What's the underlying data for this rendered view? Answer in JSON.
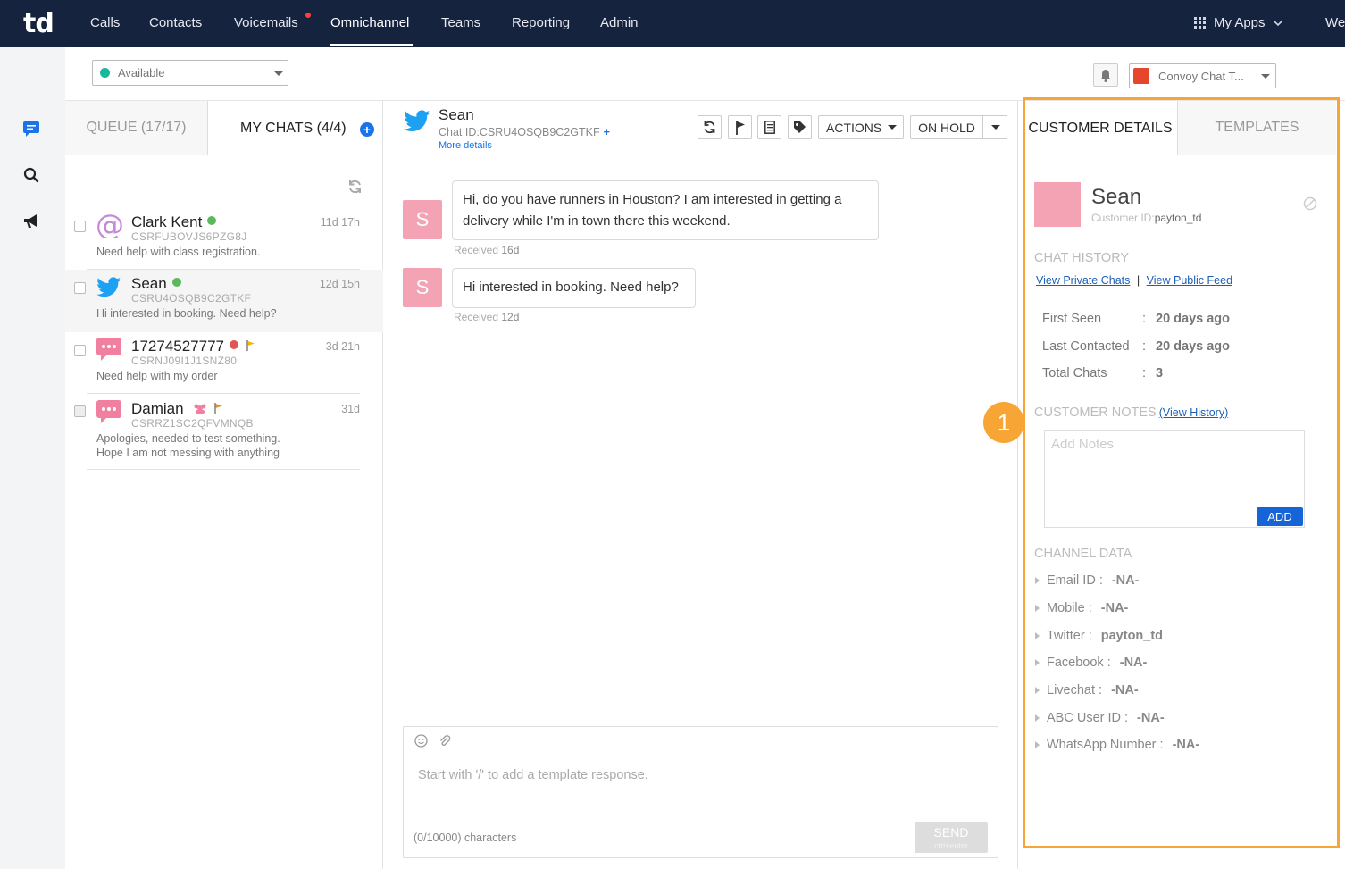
{
  "nav": {
    "logo": "td",
    "items": [
      "Calls",
      "Contacts",
      "Voicemails",
      "Omnichannel",
      "Teams",
      "Reporting",
      "Admin"
    ],
    "my_apps": "My Apps",
    "truncated": "We"
  },
  "status": {
    "value": "Available",
    "color": "#17b89b"
  },
  "integration": {
    "value": "Convoy Chat T..."
  },
  "tabs": {
    "queue": "QUEUE (17/17)",
    "my_chats": "MY CHATS (4/4)"
  },
  "chats": [
    {
      "name": "Clark Kent",
      "id": "CSRFUBOVJS6PZG8J",
      "preview": "Need help with class registration.",
      "time": "11d 17h",
      "channel": "email",
      "status_color": "#5cb85c"
    },
    {
      "name": "Sean",
      "id": "CSRU4OSQB9C2GTKF",
      "preview": "Hi interested in booking.  Need help?",
      "time": "12d 15h",
      "channel": "twitter",
      "status_color": "#5cb85c"
    },
    {
      "name": "17274527777",
      "id": "CSRNJ09I1J1SNZ80",
      "preview": "Need help with my order",
      "time": "3d 21h",
      "channel": "sms",
      "status_color": "#e25555"
    },
    {
      "name": "Damian",
      "id": "CSRRZ1SC2QFVMNQB",
      "preview": "Apologies, needed to test something.",
      "preview2": "Hope I am not messing with anything",
      "time": "31d",
      "channel": "sms"
    }
  ],
  "conversation": {
    "name": "Sean",
    "chat_id": "Chat ID:CSRU4OSQB9C2GTKF",
    "more_details": "More details",
    "actions": "ACTIONS",
    "on_hold": "ON HOLD",
    "messages": [
      {
        "avatar": "S",
        "line1": "Hi, do you have runners in Houston?  I am interested in getting a",
        "line2": "delivery while I'm in town there this weekend.",
        "received_label": "Received",
        "received": "16d"
      },
      {
        "avatar": "S",
        "line1": "Hi interested in booking.  Need help?",
        "received_label": "Received",
        "received": "12d"
      }
    ],
    "composer_placeholder": "Start with '/' to add a template response.",
    "char_count": "(0/10000) characters",
    "send": "SEND",
    "send_hint": "ctrl+enter"
  },
  "details": {
    "tab_customer": "CUSTOMER DETAILS",
    "tab_templates": "TEMPLATES",
    "name": "Sean",
    "customer_id_label": "Customer ID:",
    "customer_id": "payton_td",
    "chat_history": "CHAT HISTORY",
    "view_private": "View Private Chats",
    "view_public": "View Public Feed",
    "separator": "|",
    "stats": [
      {
        "label": "First Seen",
        "value": "20 days ago"
      },
      {
        "label": "Last Contacted",
        "value": "20 days ago"
      },
      {
        "label": "Total Chats",
        "value": "3"
      }
    ],
    "colon": ":",
    "notes_title": "CUSTOMER NOTES",
    "view_history": "(View History)",
    "notes_placeholder": "Add Notes",
    "add": "ADD",
    "channel_title": "CHANNEL DATA",
    "channels": [
      {
        "label": "Email ID :",
        "value": "-NA-"
      },
      {
        "label": "Mobile :",
        "value": "-NA-"
      },
      {
        "label": "Twitter :",
        "value": "payton_td"
      },
      {
        "label": "Facebook :",
        "value": "-NA-"
      },
      {
        "label": "Livechat :",
        "value": "-NA-"
      },
      {
        "label": "ABC User ID :",
        "value": "-NA-"
      },
      {
        "label": "WhatsApp Number :",
        "value": "-NA-"
      }
    ]
  },
  "annotation": {
    "number": "1",
    "color": "#f7a535"
  }
}
